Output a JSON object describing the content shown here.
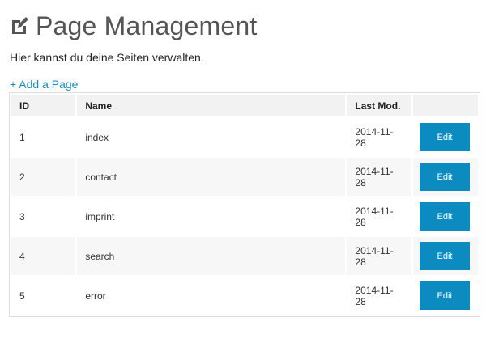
{
  "header": {
    "title": "Page Management",
    "icon": "edit-icon"
  },
  "subtitle": "Hier kannst du deine Seiten verwalten.",
  "add_link": "+ Add a Page",
  "table": {
    "columns": [
      "ID",
      "Name",
      "Last Mod.",
      ""
    ],
    "rows": [
      {
        "id": "1",
        "name": "index",
        "last_mod": "2014-11-28",
        "action": "Edit"
      },
      {
        "id": "2",
        "name": "contact",
        "last_mod": "2014-11-28",
        "action": "Edit"
      },
      {
        "id": "3",
        "name": "imprint",
        "last_mod": "2014-11-28",
        "action": "Edit"
      },
      {
        "id": "4",
        "name": "search",
        "last_mod": "2014-11-28",
        "action": "Edit"
      },
      {
        "id": "5",
        "name": "error",
        "last_mod": "2014-11-28",
        "action": "Edit"
      }
    ]
  },
  "colors": {
    "accent": "#0c8bc0",
    "link": "#1a8ab8",
    "title": "#555555"
  }
}
